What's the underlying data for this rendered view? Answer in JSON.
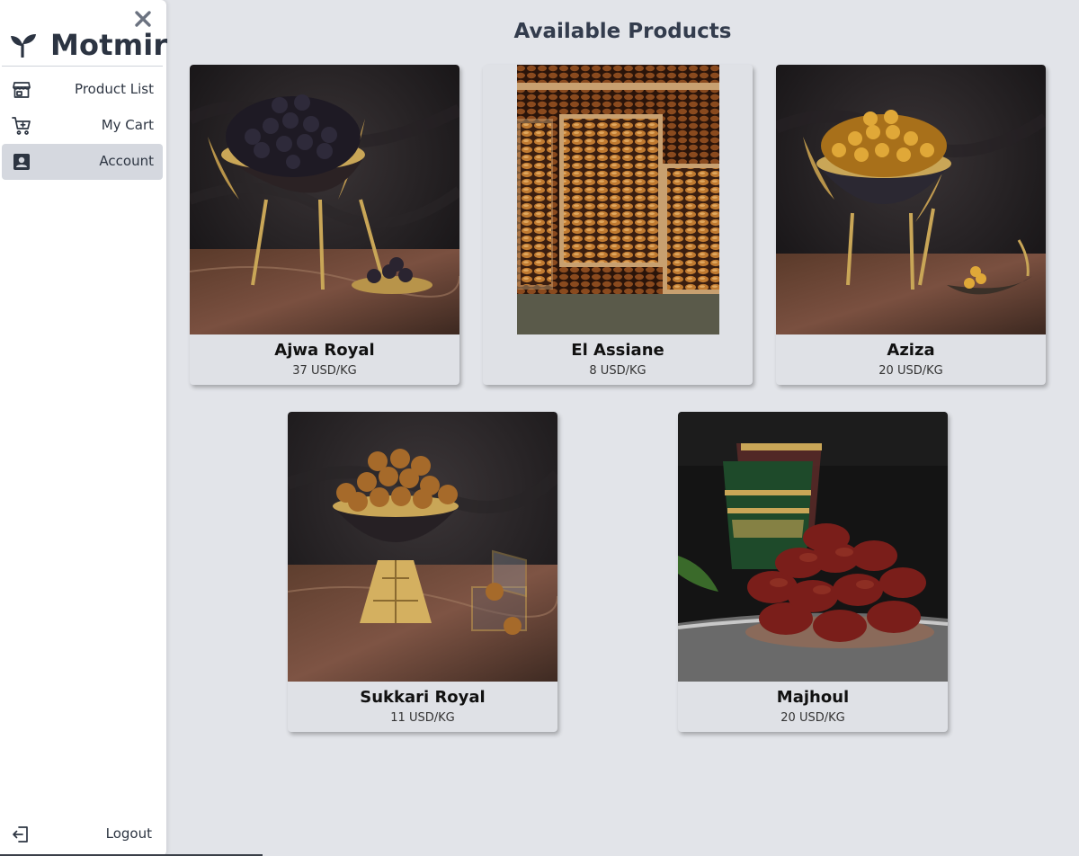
{
  "app": {
    "name": "Motmir"
  },
  "sidebar": {
    "items": [
      {
        "label": "Product List",
        "icon": "store-icon",
        "active": false
      },
      {
        "label": "My Cart",
        "icon": "cart-icon",
        "active": false
      },
      {
        "label": "Account",
        "icon": "account-icon",
        "active": true
      }
    ],
    "logout_label": "Logout"
  },
  "main": {
    "title": "Available Products",
    "products": [
      {
        "name": "Ajwa Royal",
        "price": "37 USD/KG"
      },
      {
        "name": "El Assiane",
        "price": "8 USD/KG"
      },
      {
        "name": "Aziza",
        "price": "20 USD/KG"
      },
      {
        "name": "Sukkari Royal",
        "price": "11 USD/KG"
      },
      {
        "name": "Majhoul",
        "price": "20 USD/KG"
      }
    ]
  },
  "colors": {
    "page_bg": "#e2e4e9",
    "sidebar_bg": "#ffffff",
    "active_item_bg": "#d5d8df",
    "text_dark": "#2c3442"
  }
}
